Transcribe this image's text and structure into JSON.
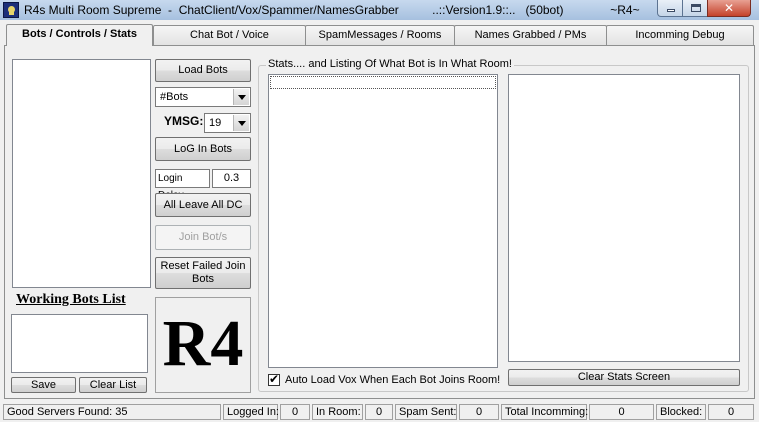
{
  "window": {
    "title": "R4s Multi Room Supreme  -  ChatClient/Vox/Spammer/NamesGrabber          ..::Version1.9::..   (50bot)              ~R4~",
    "icon": "skull-icon",
    "controls": {
      "minimize": "minimize-icon",
      "maximize": "maximize-icon",
      "close": "✕"
    }
  },
  "tabs": [
    {
      "label": "Bots / Controls / Stats",
      "active": true
    },
    {
      "label": "Chat Bot / Voice",
      "active": false
    },
    {
      "label": "SpamMessages / Rooms",
      "active": false
    },
    {
      "label": "Names Grabbed / PMs",
      "active": false
    },
    {
      "label": "Incomming Debug",
      "active": false
    }
  ],
  "left_panel": {
    "working_bots_heading": "Working Bots List",
    "save_label": "Save",
    "clear_list_label": "Clear List"
  },
  "controls": {
    "load_bots_label": "Load Bots",
    "bots_combo_value": "#Bots",
    "ymsg_label": "YMSG:",
    "ymsg_value": "19",
    "login_bots_label": "LoG In Bots",
    "login_delay_label": "Login Delay",
    "login_delay_value": "0.3",
    "all_leave_label": "All Leave All DC",
    "join_bots_label": "Join Bot/s",
    "reset_failed_label": "Reset Failed Join Bots",
    "logo_text": "R4"
  },
  "stats": {
    "group_caption": "Stats.... and Listing Of What Bot is In What Room!",
    "auto_load_vox_label": "Auto Load Vox When Each Bot Joins Room!",
    "auto_load_vox_checked": true,
    "clear_stats_label": "Clear Stats Screen"
  },
  "statusbar": {
    "good_servers": "Good Servers Found: 35",
    "logged_in_label": "Logged In:",
    "logged_in_value": "0",
    "in_room_label": "In Room:",
    "in_room_value": "0",
    "spam_sent_label": "Spam Sent:",
    "spam_sent_value": "0",
    "total_incomming_label": "Total Incomming:",
    "total_incomming_value": "0",
    "blocked_label": "Blocked:",
    "blocked_value": "0"
  }
}
